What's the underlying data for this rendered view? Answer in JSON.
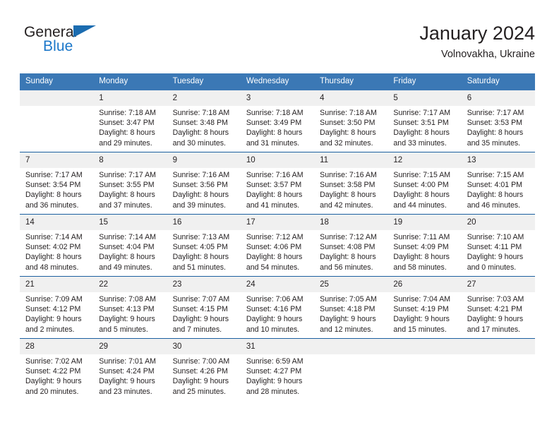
{
  "brand": {
    "line1": "General",
    "line2": "Blue",
    "triangle_color": "#1b6cb0",
    "blue_text_color": "#1b77c9"
  },
  "header": {
    "title": "January 2024",
    "subtitle": "Volnovakha, Ukraine"
  },
  "theme": {
    "header_blue": "#3b78b5",
    "row_rule_blue": "#1b5fa0",
    "daynum_band": "#f0f0f0",
    "text": "#231f20"
  },
  "weekday_headers": [
    "Sunday",
    "Monday",
    "Tuesday",
    "Wednesday",
    "Thursday",
    "Friday",
    "Saturday"
  ],
  "weeks": [
    [
      {
        "day": "",
        "lines": []
      },
      {
        "day": "1",
        "lines": [
          "Sunrise: 7:18 AM",
          "Sunset: 3:47 PM",
          "Daylight: 8 hours",
          "and 29 minutes."
        ]
      },
      {
        "day": "2",
        "lines": [
          "Sunrise: 7:18 AM",
          "Sunset: 3:48 PM",
          "Daylight: 8 hours",
          "and 30 minutes."
        ]
      },
      {
        "day": "3",
        "lines": [
          "Sunrise: 7:18 AM",
          "Sunset: 3:49 PM",
          "Daylight: 8 hours",
          "and 31 minutes."
        ]
      },
      {
        "day": "4",
        "lines": [
          "Sunrise: 7:18 AM",
          "Sunset: 3:50 PM",
          "Daylight: 8 hours",
          "and 32 minutes."
        ]
      },
      {
        "day": "5",
        "lines": [
          "Sunrise: 7:17 AM",
          "Sunset: 3:51 PM",
          "Daylight: 8 hours",
          "and 33 minutes."
        ]
      },
      {
        "day": "6",
        "lines": [
          "Sunrise: 7:17 AM",
          "Sunset: 3:53 PM",
          "Daylight: 8 hours",
          "and 35 minutes."
        ]
      }
    ],
    [
      {
        "day": "7",
        "lines": [
          "Sunrise: 7:17 AM",
          "Sunset: 3:54 PM",
          "Daylight: 8 hours",
          "and 36 minutes."
        ]
      },
      {
        "day": "8",
        "lines": [
          "Sunrise: 7:17 AM",
          "Sunset: 3:55 PM",
          "Daylight: 8 hours",
          "and 37 minutes."
        ]
      },
      {
        "day": "9",
        "lines": [
          "Sunrise: 7:16 AM",
          "Sunset: 3:56 PM",
          "Daylight: 8 hours",
          "and 39 minutes."
        ]
      },
      {
        "day": "10",
        "lines": [
          "Sunrise: 7:16 AM",
          "Sunset: 3:57 PM",
          "Daylight: 8 hours",
          "and 41 minutes."
        ]
      },
      {
        "day": "11",
        "lines": [
          "Sunrise: 7:16 AM",
          "Sunset: 3:58 PM",
          "Daylight: 8 hours",
          "and 42 minutes."
        ]
      },
      {
        "day": "12",
        "lines": [
          "Sunrise: 7:15 AM",
          "Sunset: 4:00 PM",
          "Daylight: 8 hours",
          "and 44 minutes."
        ]
      },
      {
        "day": "13",
        "lines": [
          "Sunrise: 7:15 AM",
          "Sunset: 4:01 PM",
          "Daylight: 8 hours",
          "and 46 minutes."
        ]
      }
    ],
    [
      {
        "day": "14",
        "lines": [
          "Sunrise: 7:14 AM",
          "Sunset: 4:02 PM",
          "Daylight: 8 hours",
          "and 48 minutes."
        ]
      },
      {
        "day": "15",
        "lines": [
          "Sunrise: 7:14 AM",
          "Sunset: 4:04 PM",
          "Daylight: 8 hours",
          "and 49 minutes."
        ]
      },
      {
        "day": "16",
        "lines": [
          "Sunrise: 7:13 AM",
          "Sunset: 4:05 PM",
          "Daylight: 8 hours",
          "and 51 minutes."
        ]
      },
      {
        "day": "17",
        "lines": [
          "Sunrise: 7:12 AM",
          "Sunset: 4:06 PM",
          "Daylight: 8 hours",
          "and 54 minutes."
        ]
      },
      {
        "day": "18",
        "lines": [
          "Sunrise: 7:12 AM",
          "Sunset: 4:08 PM",
          "Daylight: 8 hours",
          "and 56 minutes."
        ]
      },
      {
        "day": "19",
        "lines": [
          "Sunrise: 7:11 AM",
          "Sunset: 4:09 PM",
          "Daylight: 8 hours",
          "and 58 minutes."
        ]
      },
      {
        "day": "20",
        "lines": [
          "Sunrise: 7:10 AM",
          "Sunset: 4:11 PM",
          "Daylight: 9 hours",
          "and 0 minutes."
        ]
      }
    ],
    [
      {
        "day": "21",
        "lines": [
          "Sunrise: 7:09 AM",
          "Sunset: 4:12 PM",
          "Daylight: 9 hours",
          "and 2 minutes."
        ]
      },
      {
        "day": "22",
        "lines": [
          "Sunrise: 7:08 AM",
          "Sunset: 4:13 PM",
          "Daylight: 9 hours",
          "and 5 minutes."
        ]
      },
      {
        "day": "23",
        "lines": [
          "Sunrise: 7:07 AM",
          "Sunset: 4:15 PM",
          "Daylight: 9 hours",
          "and 7 minutes."
        ]
      },
      {
        "day": "24",
        "lines": [
          "Sunrise: 7:06 AM",
          "Sunset: 4:16 PM",
          "Daylight: 9 hours",
          "and 10 minutes."
        ]
      },
      {
        "day": "25",
        "lines": [
          "Sunrise: 7:05 AM",
          "Sunset: 4:18 PM",
          "Daylight: 9 hours",
          "and 12 minutes."
        ]
      },
      {
        "day": "26",
        "lines": [
          "Sunrise: 7:04 AM",
          "Sunset: 4:19 PM",
          "Daylight: 9 hours",
          "and 15 minutes."
        ]
      },
      {
        "day": "27",
        "lines": [
          "Sunrise: 7:03 AM",
          "Sunset: 4:21 PM",
          "Daylight: 9 hours",
          "and 17 minutes."
        ]
      }
    ],
    [
      {
        "day": "28",
        "lines": [
          "Sunrise: 7:02 AM",
          "Sunset: 4:22 PM",
          "Daylight: 9 hours",
          "and 20 minutes."
        ]
      },
      {
        "day": "29",
        "lines": [
          "Sunrise: 7:01 AM",
          "Sunset: 4:24 PM",
          "Daylight: 9 hours",
          "and 23 minutes."
        ]
      },
      {
        "day": "30",
        "lines": [
          "Sunrise: 7:00 AM",
          "Sunset: 4:26 PM",
          "Daylight: 9 hours",
          "and 25 minutes."
        ]
      },
      {
        "day": "31",
        "lines": [
          "Sunrise: 6:59 AM",
          "Sunset: 4:27 PM",
          "Daylight: 9 hours",
          "and 28 minutes."
        ]
      },
      {
        "day": "",
        "lines": []
      },
      {
        "day": "",
        "lines": []
      },
      {
        "day": "",
        "lines": []
      }
    ]
  ]
}
